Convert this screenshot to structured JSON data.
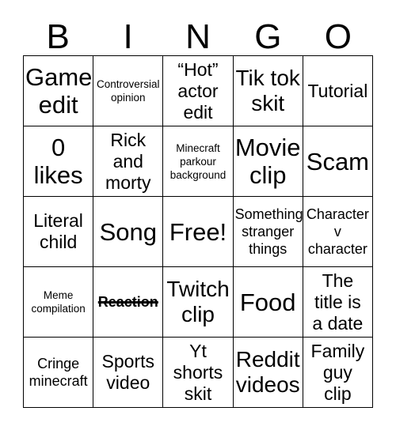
{
  "card": {
    "header_letters": [
      "B",
      "I",
      "N",
      "G",
      "O"
    ],
    "rows": [
      [
        {
          "text": "Game\nedit",
          "size": "xl",
          "marked": false
        },
        {
          "text": "Controversial\nopinion",
          "size": "xs",
          "marked": false
        },
        {
          "text": "“Hot”\nactor\nedit",
          "size": "md",
          "marked": false
        },
        {
          "text": "Tik tok\nskit",
          "size": "lg",
          "marked": false
        },
        {
          "text": "Tutorial",
          "size": "md",
          "marked": false
        }
      ],
      [
        {
          "text": "0\nlikes",
          "size": "xl",
          "marked": false
        },
        {
          "text": "Rick\nand\nmorty",
          "size": "md",
          "marked": false
        },
        {
          "text": "Minecraft\nparkour\nbackground",
          "size": "xs",
          "marked": false
        },
        {
          "text": "Movie\nclip",
          "size": "xl",
          "marked": false
        },
        {
          "text": "Scam",
          "size": "xl",
          "marked": false
        }
      ],
      [
        {
          "text": "Literal\nchild",
          "size": "md",
          "marked": false
        },
        {
          "text": "Song",
          "size": "xl",
          "marked": false
        },
        {
          "text": "Free!",
          "size": "xl",
          "marked": false
        },
        {
          "text": "Something\nstranger\nthings",
          "size": "sm",
          "marked": false
        },
        {
          "text": "Character\nv\ncharacter",
          "size": "sm",
          "marked": false
        }
      ],
      [
        {
          "text": "Meme\ncompilation",
          "size": "xs",
          "marked": false
        },
        {
          "text": "Reaction",
          "size": "sm",
          "marked": true
        },
        {
          "text": "Twitch\nclip",
          "size": "lg",
          "marked": false
        },
        {
          "text": "Food",
          "size": "xl",
          "marked": false
        },
        {
          "text": "The\ntitle is\na date",
          "size": "md",
          "marked": false
        }
      ],
      [
        {
          "text": "Cringe\nminecraft",
          "size": "sm",
          "marked": false
        },
        {
          "text": "Sports\nvideo",
          "size": "md",
          "marked": false
        },
        {
          "text": "Yt\nshorts\nskit",
          "size": "md",
          "marked": false
        },
        {
          "text": "Reddit\nvideos",
          "size": "lg",
          "marked": false
        },
        {
          "text": "Family\nguy\nclip",
          "size": "md",
          "marked": false
        }
      ]
    ]
  }
}
